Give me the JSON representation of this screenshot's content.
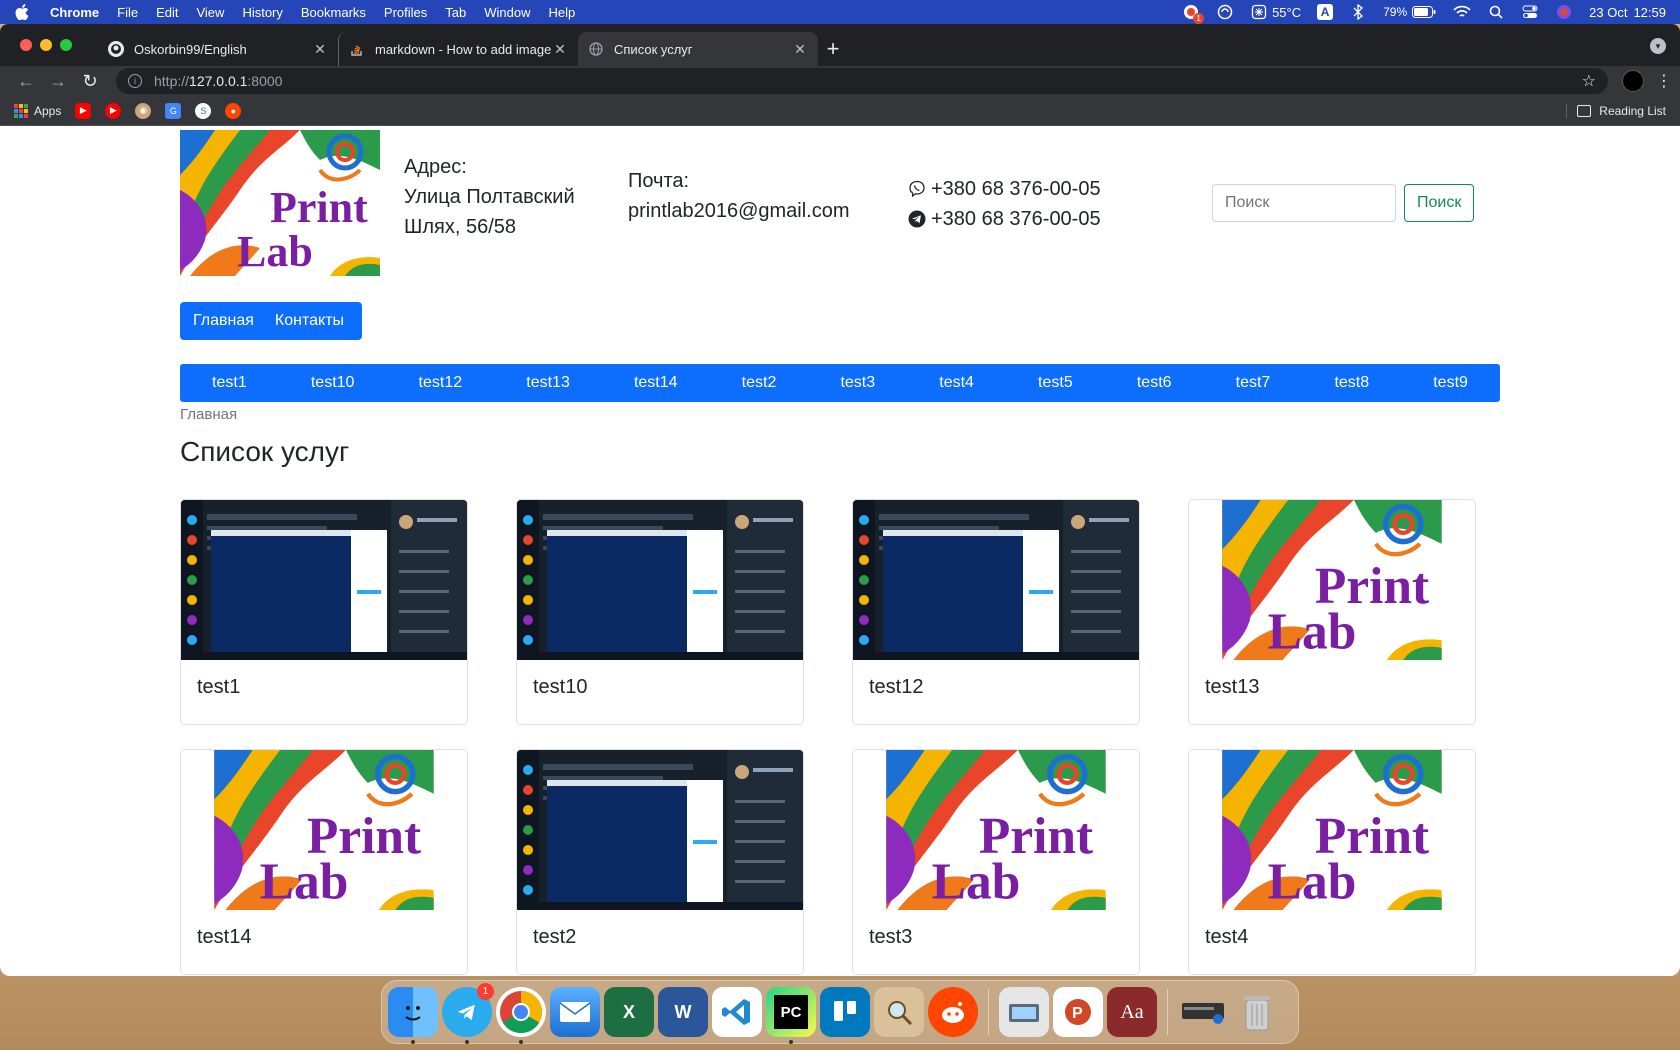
{
  "menubar": {
    "app": "Chrome",
    "items": [
      "File",
      "Edit",
      "View",
      "History",
      "Bookmarks",
      "Profiles",
      "Tab",
      "Window",
      "Help"
    ],
    "status": {
      "badge": "1",
      "temp": "55°C",
      "input": "A",
      "battery": "79%",
      "date": "23 Oct",
      "time": "12:59"
    }
  },
  "browser": {
    "tabs": [
      {
        "title": "Oskorbin99/English",
        "icon": "github-icon"
      },
      {
        "title": "markdown - How to add image",
        "icon": "stackoverflow-icon"
      },
      {
        "title": "Список услуг",
        "icon": "globe-icon"
      }
    ],
    "url_scheme": "http://",
    "url_host": "127.0.0.1",
    "url_port": ":8000",
    "bookmarks": {
      "apps": "Apps",
      "reading_list": "Reading List"
    }
  },
  "site": {
    "logo_text": [
      "Print",
      "Lab"
    ],
    "address": {
      "label": "Адрес:",
      "line1": "Улица Полтавский",
      "line2": "Шлях, 56/58"
    },
    "email": {
      "label": "Почта:",
      "value": "printlab2016@gmail.com"
    },
    "phones": [
      "+380 68 376-00-05",
      "+380 68 376-00-05"
    ],
    "search": {
      "placeholder": "Поиск",
      "button": "Поиск"
    },
    "main_nav": [
      "Главная",
      "Контакты"
    ],
    "categories": [
      "test1",
      "test10",
      "test12",
      "test13",
      "test14",
      "test2",
      "test3",
      "test4",
      "test5",
      "test6",
      "test7",
      "test8",
      "test9"
    ],
    "breadcrumb": "Главная",
    "page_title": "Список услуг",
    "cards": [
      {
        "title": "test1",
        "image": "screenshot"
      },
      {
        "title": "test10",
        "image": "screenshot"
      },
      {
        "title": "test12",
        "image": "screenshot"
      },
      {
        "title": "test13",
        "image": "logo"
      },
      {
        "title": "test14",
        "image": "logo"
      },
      {
        "title": "test2",
        "image": "screenshot"
      },
      {
        "title": "test3",
        "image": "logo"
      },
      {
        "title": "test4",
        "image": "logo"
      }
    ]
  },
  "dock": {
    "telegram_badge": "1",
    "pycharm_label": "PC",
    "dictionary_label": "Aa",
    "excel_label": "X",
    "word_label": "W"
  },
  "colors": {
    "primary": "#0d6efd",
    "success": "#198754",
    "menubar": "#2546b8",
    "logo_purple": "#7a1fa2"
  }
}
